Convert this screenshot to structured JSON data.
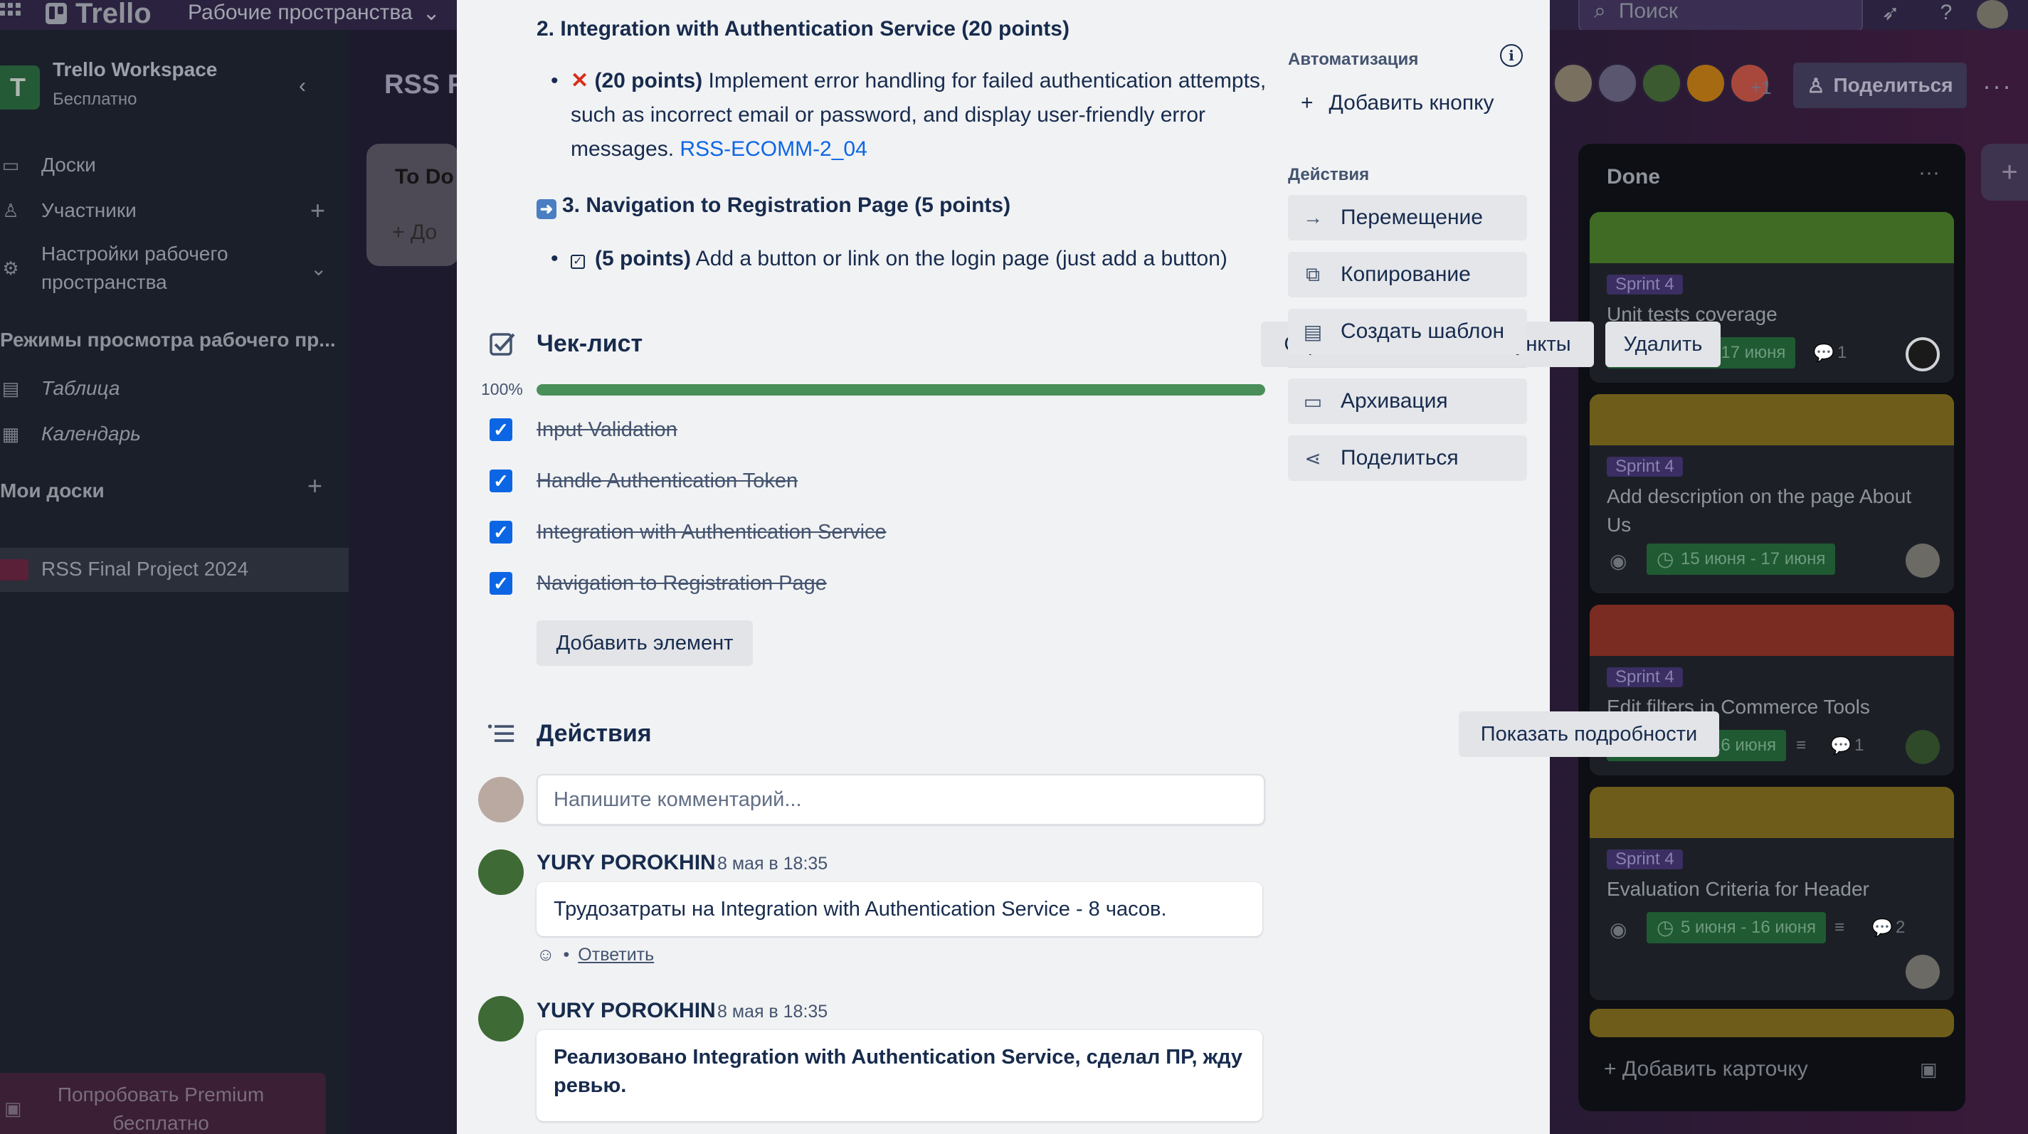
{
  "topbar": {
    "logo": "Trello",
    "workspaces": "Рабочие пространства",
    "search_placeholder": "Поиск"
  },
  "sidebar": {
    "badge": "T",
    "workspace_name": "Trello Workspace",
    "plan": "Бесплатно",
    "items": [
      {
        "label": "Доски",
        "icon": "board-icon"
      },
      {
        "label": "Участники",
        "icon": "person-icon"
      },
      {
        "label": "Настройки рабочего пространства",
        "icon": "gear-icon"
      }
    ],
    "views_title": "Режимы просмотра рабочего пр...",
    "views": [
      {
        "label": "Таблица",
        "icon": "table-icon"
      },
      {
        "label": "Календарь",
        "icon": "calendar-icon"
      }
    ],
    "my_boards_title": "Мои доски",
    "boards": [
      "RSS Final Project 2024"
    ],
    "premium": "Попробовать Premium бесплатно"
  },
  "board": {
    "title": "RSS F",
    "extra_members": "+1",
    "share": "Поделиться",
    "todo_list_title": "To Do",
    "todo_add": "До",
    "done_list": {
      "title": "Done",
      "cards": [
        {
          "cover": "#3f6b24",
          "label": "Sprint 4",
          "title": "Unit tests coverage",
          "dates": "15 июня - 17 июня",
          "comments": "1"
        },
        {
          "cover": "#6e5d1a",
          "label": "Sprint 4",
          "title": "Add description on the page About Us",
          "dates": "15 июня - 17 июня"
        },
        {
          "cover": "#7a2b22",
          "label": "Sprint 4",
          "title": "Edit filters in Commerce Tools",
          "dates": "2 июня - 16 июня",
          "comments": "1"
        },
        {
          "cover": "#6e5d1a",
          "label": "Sprint 4",
          "title": "Evaluation Criteria for Header",
          "dates": "5 июня - 16 июня",
          "comments": "2"
        }
      ],
      "add_card": "Добавить карточку"
    }
  },
  "modal": {
    "description": {
      "heading2": "2. Integration with Authentication Service (20 points)",
      "item2_points": "(20 points)",
      "item2_text": " Implement error handling for failed authentication attempts, such as incorrect email or password, and display user-friendly error messages. ",
      "item2_link": "RSS-ECOMM-2_04",
      "heading3": "3. Navigation to Registration Page (5 points)",
      "item3_points": "(5 points)",
      "item3_text": " Add a button or link on the login page (just add a button)"
    },
    "checklist": {
      "title": "Чек-лист",
      "hide_checked": "Скрывать отмеченные пункты",
      "delete": "Удалить",
      "progress_label": "100%",
      "progress": 1.0,
      "items": [
        "Input Validation",
        "Handle Authentication Token",
        "Integration with Authentication Service",
        "Navigation to Registration Page"
      ],
      "add_item": "Добавить элемент"
    },
    "activity": {
      "title": "Действия",
      "show_details": "Показать подробности",
      "comment_placeholder": "Напишите комментарий...",
      "comments": [
        {
          "author": "YURY POROKHIN",
          "time": "8 мая в 18:35",
          "text": "Трудозатраты на Integration with Authentication Service - 8 часов.",
          "reply": "Ответить"
        },
        {
          "author": "YURY POROKHIN",
          "time": "8 мая в 18:35",
          "text": "Реализовано Integration with Authentication Service, сделал ПР, жду ревью."
        }
      ]
    },
    "sidebar": {
      "automation_title": "Автоматизация",
      "add_button": "Добавить кнопку",
      "actions_title": "Действия",
      "actions": [
        {
          "label": "Перемещение",
          "icon": "arrow-right-icon"
        },
        {
          "label": "Копирование",
          "icon": "copy-icon"
        },
        {
          "label": "Создать шаблон",
          "icon": "template-icon"
        }
      ],
      "actions2": [
        {
          "label": "Архивация",
          "icon": "archive-icon"
        },
        {
          "label": "Поделиться",
          "icon": "share-icon"
        }
      ]
    }
  }
}
